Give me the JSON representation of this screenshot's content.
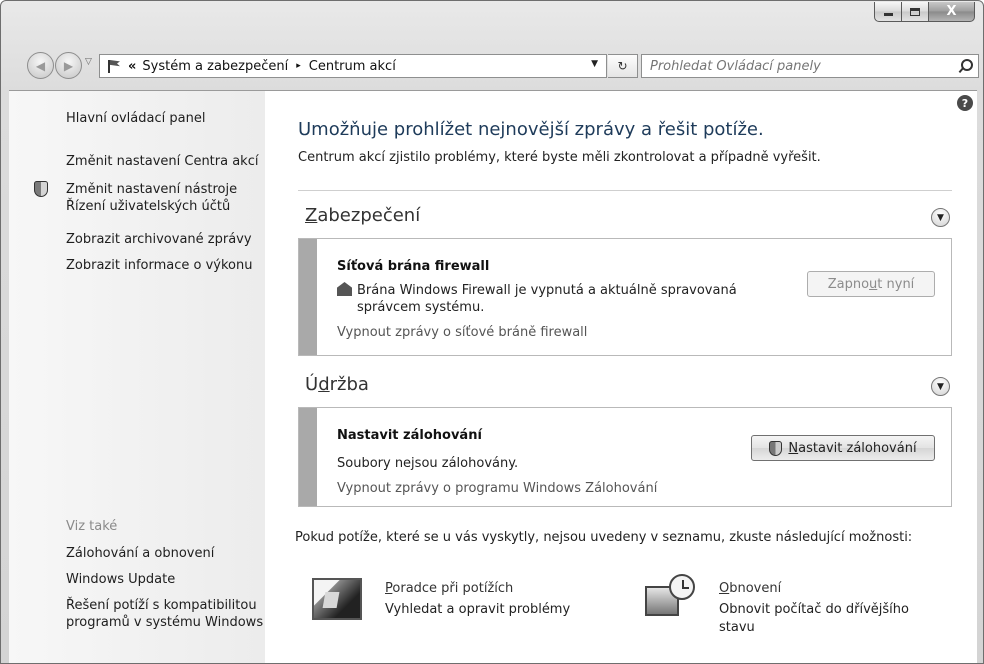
{
  "window": {
    "minimize_label": "",
    "maximize_label": "",
    "close_label": "X"
  },
  "address_bar": {
    "chevrons": "«",
    "crumbs": [
      "Systém a zabezpečení",
      "Centrum akcí"
    ],
    "separator": "▸"
  },
  "search": {
    "placeholder": "Prohledat Ovládací panely"
  },
  "sidebar": {
    "links": [
      "Hlavní ovládací panel",
      "Změnit nastavení Centra akcí",
      "Změnit nastavení nástroje",
      "Řízení uživatelských účtů",
      "Zobrazit archivované zprávy",
      "Zobrazit informace o výkonu"
    ],
    "see_also": "Viz také",
    "see_also_links": [
      "Zálohování a obnovení",
      "Windows Update",
      "Řešení potíží s kompatibilitou",
      "programů v systému Windows"
    ]
  },
  "main": {
    "title": "Umožňuje prohlížet nejnovější zprávy a řešit potíže.",
    "subtitle": "Centrum akcí zjistilo problémy, které byste měli zkontrolovat a případně vyřešit.",
    "security": {
      "heading_u": "Z",
      "heading_rest": "abezpečení",
      "card_title": "Síťová brána firewall",
      "card_text_1": "Brána Windows Firewall je vypnutá a aktuálně spravovaná",
      "card_text_2": "správcem systému.",
      "card_link": "Vypnout zprávy o síťové bráně firewall",
      "button_pre": "Zapno",
      "button_u": "u",
      "button_post": "t nyní"
    },
    "maintenance": {
      "heading_pre": "Ú",
      "heading_u": "d",
      "heading_rest": "ržba",
      "card_title": "Nastavit zálohování",
      "card_text": "Soubory nejsou zálohovány.",
      "card_link": "Vypnout zprávy o programu Windows Zálohování",
      "button_u": "N",
      "button_rest": "astavit zálohování"
    },
    "bottom_note": "Pokud potíže, které se u vás vyskytly, nejsou uvedeny v seznamu, zkuste následující možnosti:",
    "options": [
      {
        "title_u": "P",
        "title_rest": "oradce při potížích",
        "desc_1": "Vyhledat a opravit problémy",
        "desc_2": ""
      },
      {
        "title_u": "O",
        "title_rest": "bnovení",
        "desc_1": "Obnovit počítač do dřívějšího",
        "desc_2": "stavu"
      }
    ]
  },
  "help_glyph": "?"
}
